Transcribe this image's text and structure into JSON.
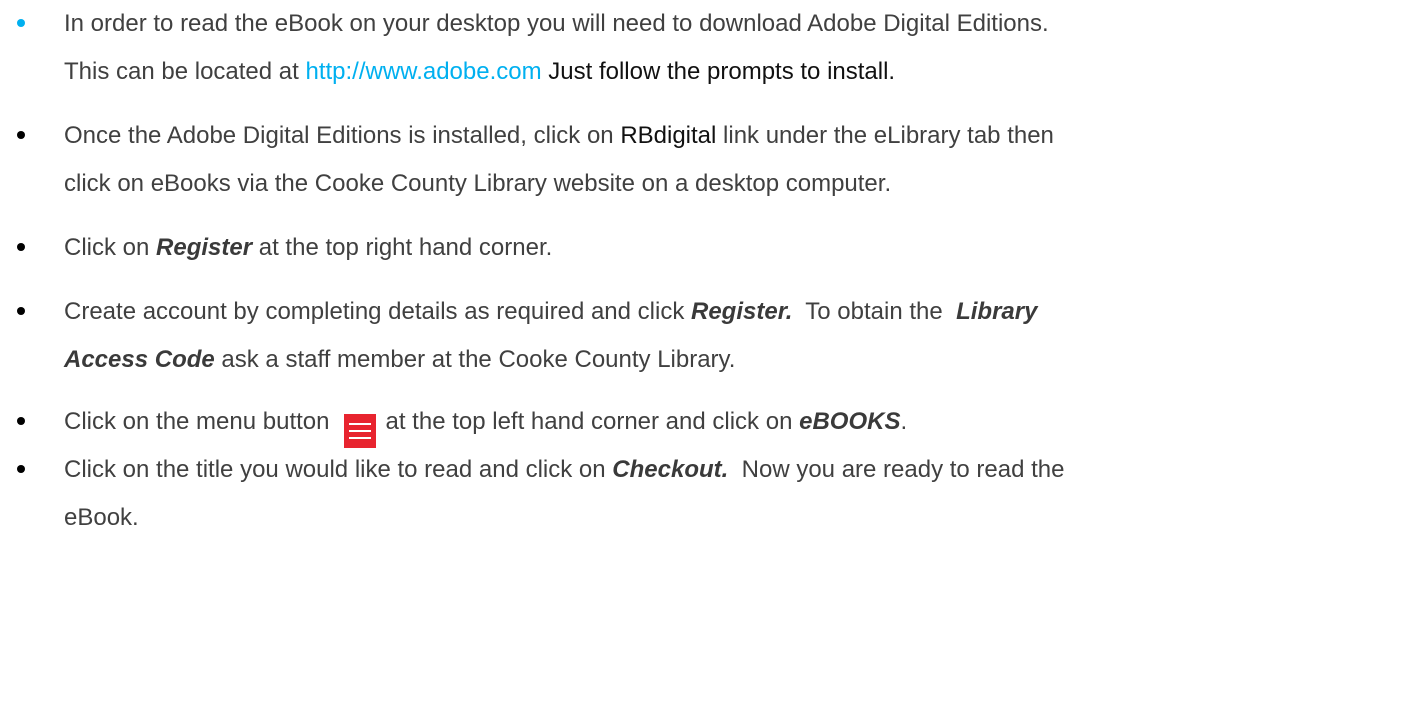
{
  "instructions": {
    "item1": {
      "line1": "In order to read the eBook on your desktop you will need to download Adobe Digital Editions.",
      "line2_before": "This can be located at ",
      "link": "http://www.adobe.com",
      "line2_after": " Just follow the prompts to install."
    },
    "item2": {
      "line1_before": "Once the Adobe Digital Editions is installed, click on ",
      "rbdigital": "RBdigital",
      "line1_after": " link under the eLibrary tab then",
      "line2": "click on eBooks via the Cooke County Library website on a desktop computer."
    },
    "item3": {
      "before": "Click on ",
      "register": "Register",
      "after": " at the top right hand corner."
    },
    "item4": {
      "line1_before": "Create account by completing details as required and click ",
      "register": "Register.",
      "line1_mid": "  To obtain the  ",
      "library": "Library",
      "access_code": "Access Code",
      "line2_after": " ask a staff member at the Cooke County Library."
    },
    "item5": {
      "before": "Click on the menu button",
      "after": "at the top left hand corner and click on ",
      "ebooks": "eBOOKS",
      "period": "."
    },
    "item6": {
      "line1_before": "Click on the title you would like to read and click on ",
      "checkout": "Checkout.",
      "line1_after": "  Now you are ready to read the",
      "line2": "eBook."
    }
  },
  "colors": {
    "link": "#00b0f0",
    "text": "#404040",
    "menu_icon": "#e8242f"
  },
  "icons": {
    "menu": "hamburger-menu-icon"
  }
}
